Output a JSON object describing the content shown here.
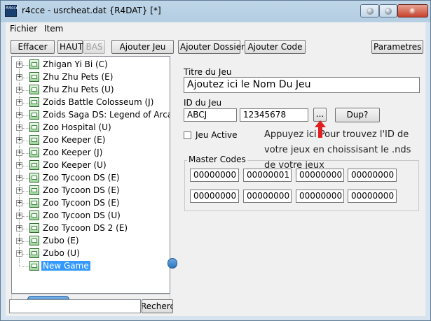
{
  "window": {
    "title": "r4cce - usrcheat.dat {R4DAT} [*]",
    "icon_text": "R4cce"
  },
  "menu": [
    "Fichier",
    "Item"
  ],
  "toolbar": {
    "effacer": "Effacer",
    "haut": "HAUT",
    "bas": "BAS",
    "ajouter_jeu": "Ajouter Jeu",
    "ajouter_dossier": "Ajouter Dossier",
    "ajouter_code": "Ajouter Code",
    "parametres": "Parametres"
  },
  "tree": {
    "items": [
      "Zhigan Yi Bi (C)",
      "Zhu Zhu Pets (E)",
      "Zhu Zhu Pets (U)",
      "Zoids Battle Colosseum (J)",
      "Zoids Saga DS: Legend of Arcadia",
      "Zoo Hospital (U)",
      "Zoo Keeper (E)",
      "Zoo Keeper (J)",
      "Zoo Keeper (U)",
      "Zoo Tycoon DS (E)",
      "Zoo Tycoon DS (E)",
      "Zoo Tycoon DS (E)",
      "Zoo Tycoon DS (U)",
      "Zoo Tycoon DS 2 (E)",
      "Zubo (E)",
      "Zubo (U)"
    ],
    "selected_item": "New Game"
  },
  "search": {
    "value": "",
    "button": "Recherche"
  },
  "form": {
    "titre_label": "Titre du Jeu",
    "titre_value": "Ajoutez ici le Nom Du Jeu",
    "id_label": "ID du Jeu",
    "id_value": "ABCJ",
    "crc_value": "12345678",
    "browse_button": "...",
    "dup_button": "Dup?",
    "active_label": "Jeu Active",
    "active_checked": false
  },
  "master_codes": {
    "label": "Master Codes",
    "values": [
      "00000000",
      "00000001",
      "00000000",
      "00000000",
      "00000000",
      "00000000",
      "00000000",
      "00000000"
    ]
  },
  "annotation": {
    "lines": [
      "Appuyez ici Pour trouvez l'ID de",
      "votre jeux en choissisant le .nds",
      "de votre jeux"
    ],
    "arrow_color": "#e02020"
  }
}
